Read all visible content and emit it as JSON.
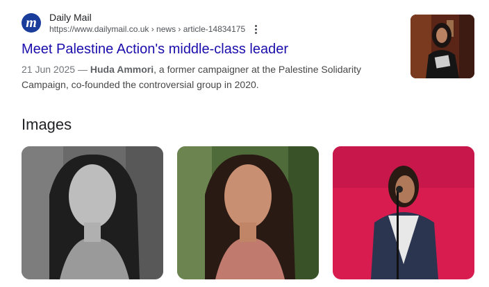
{
  "result": {
    "site_name": "Daily Mail",
    "favicon_letter": "m",
    "url": "https://www.dailymail.co.uk › news › article-14834175",
    "title": "Meet Palestine Action's middle-class leader",
    "date": "21 Jun 2025",
    "date_sep": " — ",
    "highlight_name": "Huda Ammori",
    "snippet_rest": ", a former campaigner at the Palestine Solidarity Campaign, co-founded the controversial group in 2020.",
    "more_icon": "vertical-dots-icon"
  },
  "images_section": {
    "heading": "Images",
    "cards": [
      {
        "style": "black-and-white portrait"
      },
      {
        "style": "color portrait"
      },
      {
        "style": "speaking at microphone, red background"
      }
    ]
  },
  "colors": {
    "link": "#1a0dab",
    "favicon_bg": "#1a3d9c",
    "snippet": "#474747"
  }
}
